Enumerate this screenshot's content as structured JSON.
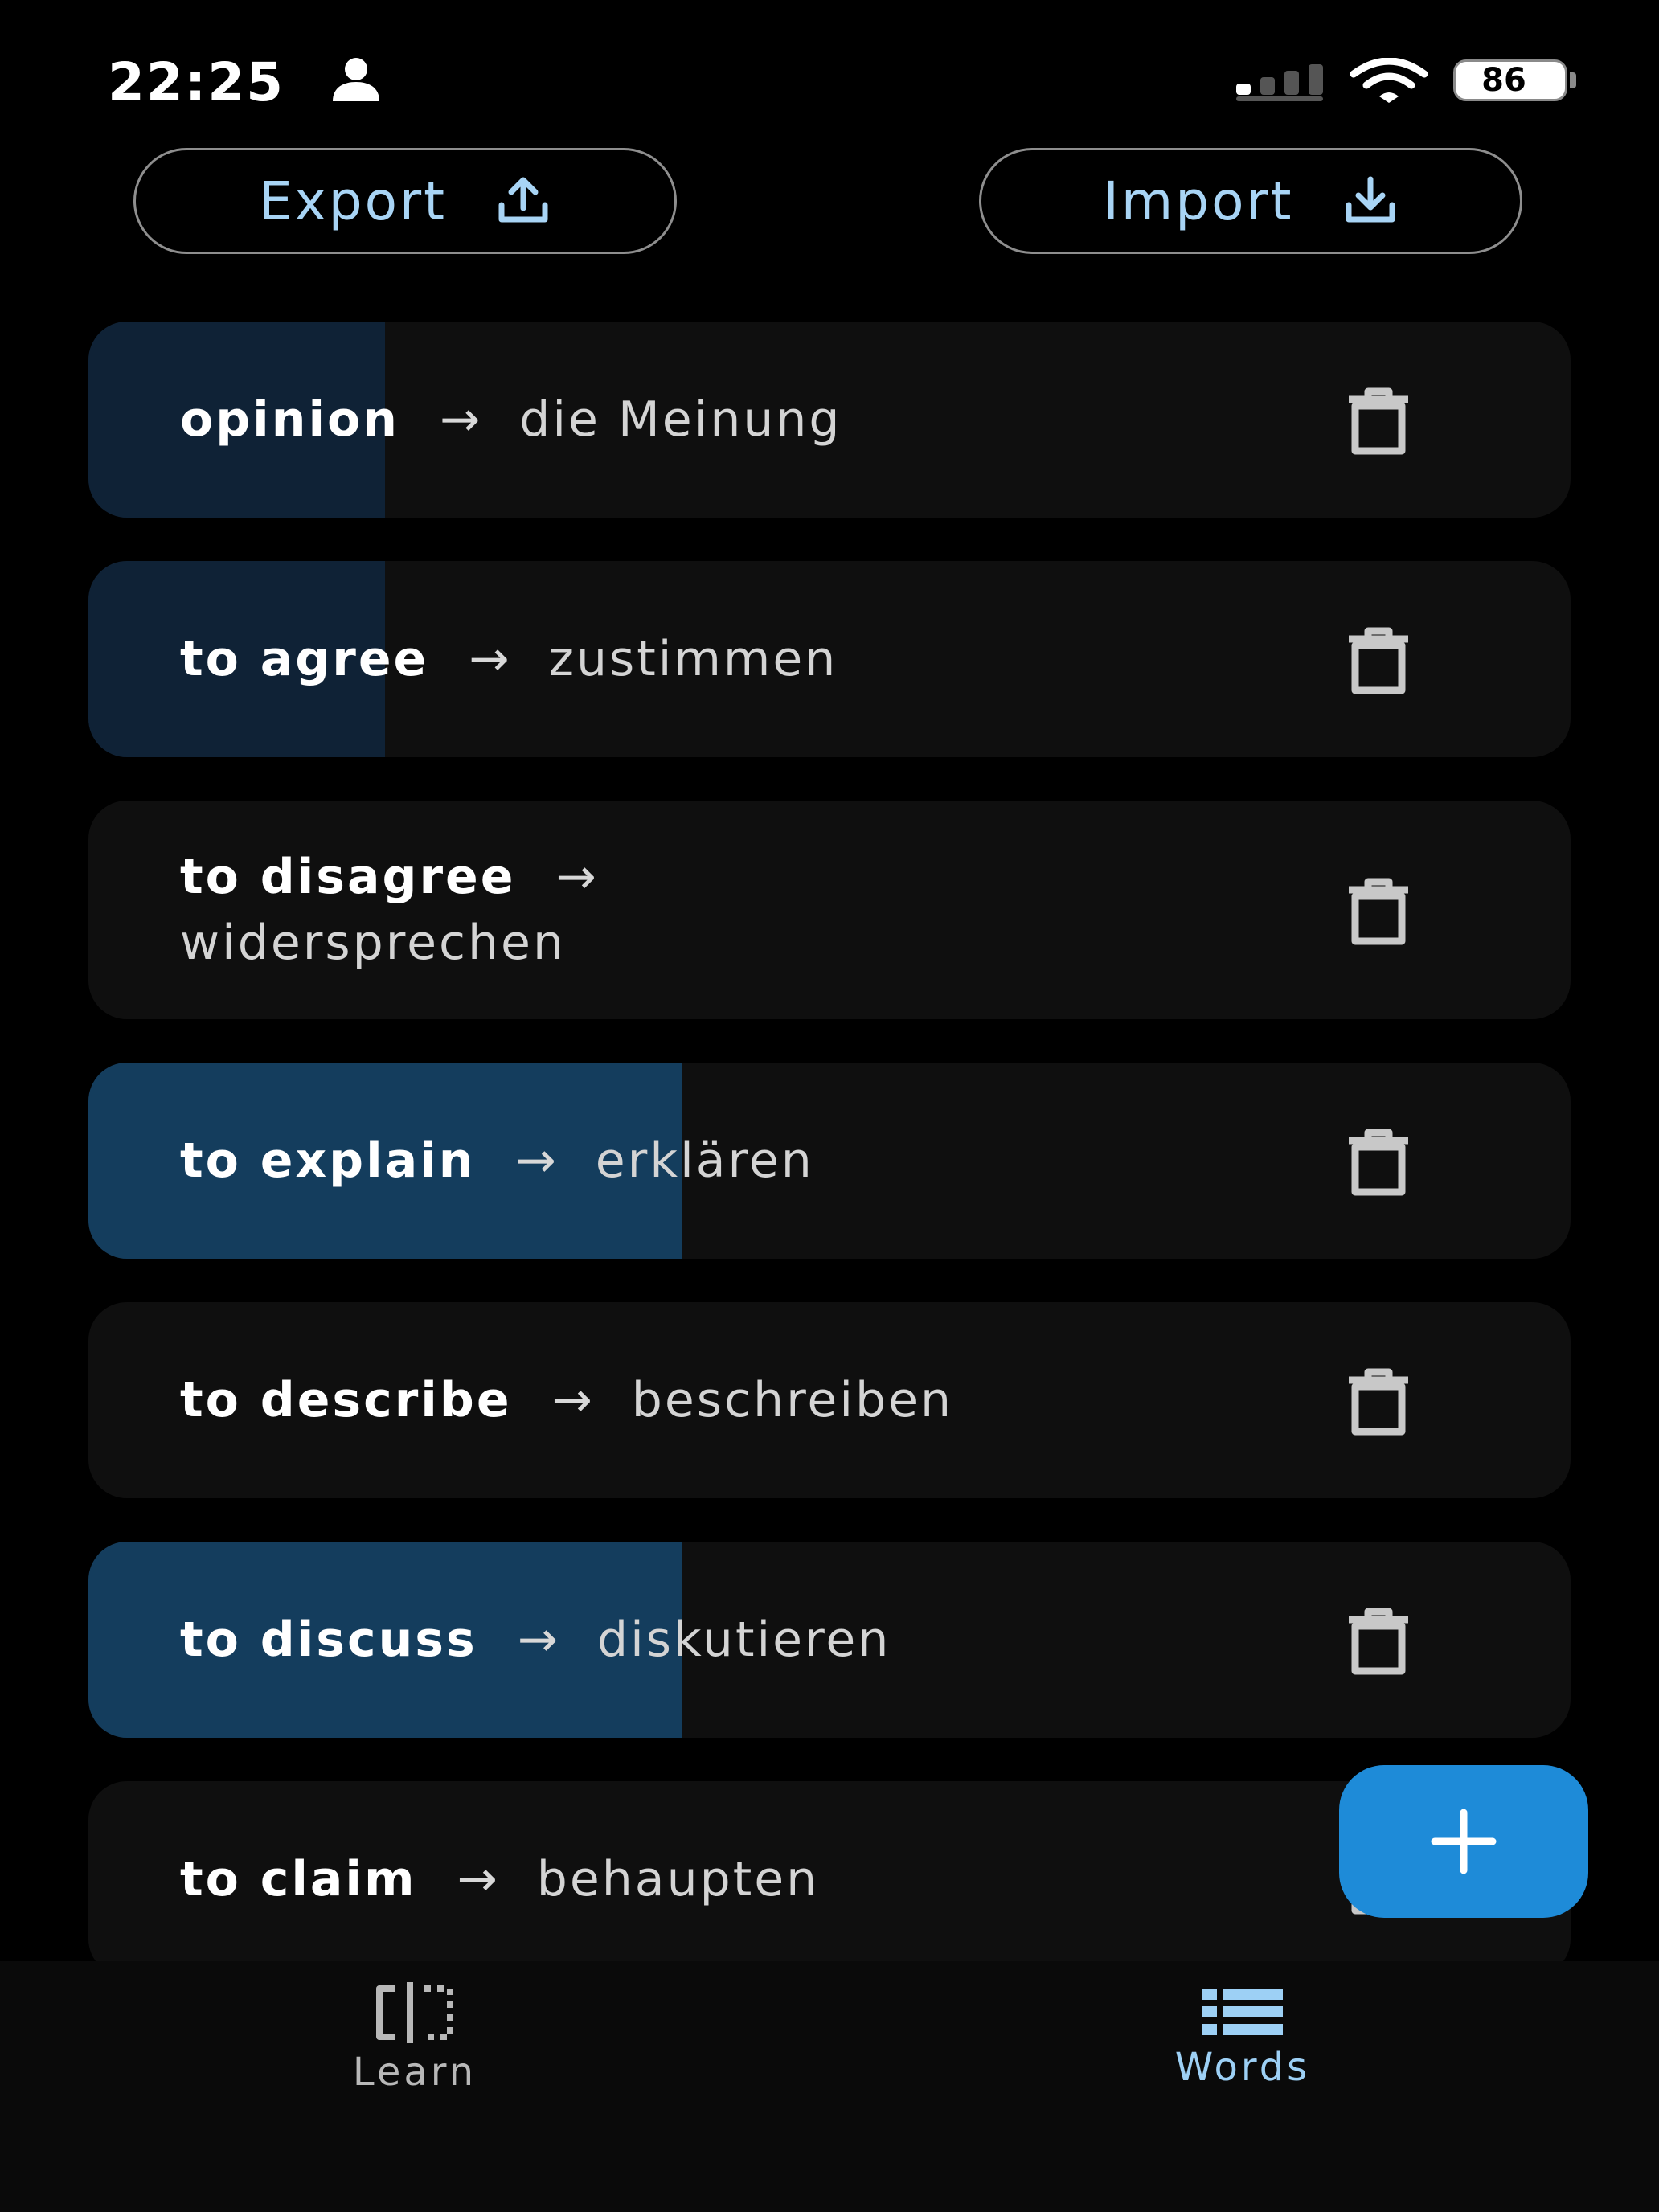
{
  "status_bar": {
    "time": "22:25",
    "battery": "86"
  },
  "toolbar": {
    "export_label": "Export",
    "import_label": "Import"
  },
  "words": [
    {
      "term": "opinion",
      "translation": "die Meinung",
      "progress": 0.2
    },
    {
      "term": "to agree",
      "translation": "zustimmen",
      "progress": 0.2
    },
    {
      "term": "to disagree",
      "translation": "widersprechen",
      "progress": 0
    },
    {
      "term": "to explain",
      "translation": "erklären",
      "progress": 0.4
    },
    {
      "term": "to describe",
      "translation": "beschreiben",
      "progress": 0
    },
    {
      "term": "to discuss",
      "translation": "diskutieren",
      "progress": 0.4
    },
    {
      "term": "to claim",
      "translation": "behaupten",
      "progress": 0
    }
  ],
  "arrow": "→",
  "fab": {
    "icon": "plus-icon"
  },
  "nav": {
    "learn_label": "Learn",
    "words_label": "Words",
    "active": "words"
  },
  "colors": {
    "accent": "#1e8bd8",
    "accent_text": "#a8d4f5",
    "progress_low": "#0f2236",
    "progress_mid": "#143d5d",
    "card_bg": "#0f0f0f"
  }
}
